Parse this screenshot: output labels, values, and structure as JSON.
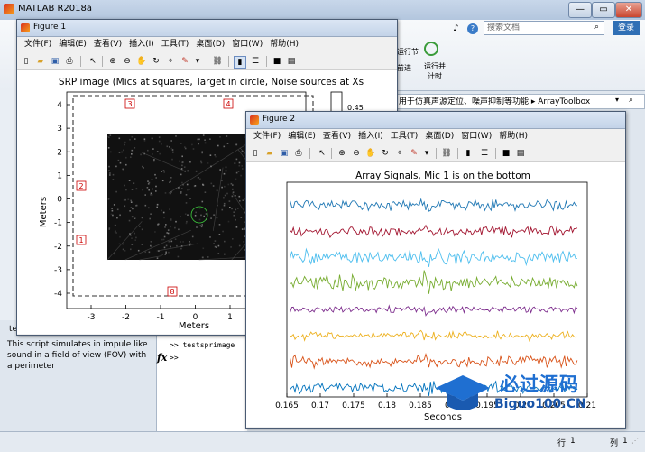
{
  "matlab": {
    "title": "MATLAB R2018a",
    "search_placeholder": "搜索文档",
    "login": "登录",
    "ribbon_run_section": "运行节",
    "ribbon_advance": "前进",
    "ribbon_run_time": "运行并\n计时",
    "path_text": "用于仿真声源定位、噪声抑制等功能 ▸ ArrayToolbox",
    "detail_text": "This script simulates in impule like sound in a field of view (FOV) with a perimeter",
    "cmd_prompt1": ">> testsprimage",
    "cmd_prompt2": ">>",
    "fx": "fx",
    "status_row_label": "行",
    "status_row": "1",
    "status_col_label": "列",
    "status_col": "1",
    "side_label": "te"
  },
  "figure1": {
    "title": "Figure 1",
    "menus": [
      "文件(F)",
      "编辑(E)",
      "查看(V)",
      "插入(I)",
      "工具(T)",
      "桌面(D)",
      "窗口(W)",
      "帮助(H)"
    ],
    "plot_title": "SRP image (Mics at squares, Target in circle, Noise sources at Xs",
    "xlabel": "Meters",
    "ylabel": "Meters",
    "colorbar_tick": "0.45",
    "mics": [
      "1",
      "2",
      "3",
      "4",
      "8"
    ],
    "xticks": [
      "-3",
      "-2",
      "-1",
      "0",
      "1"
    ],
    "yticks": [
      "4",
      "3",
      "2",
      "1",
      "0",
      "-1",
      "-2",
      "-3",
      "-4"
    ]
  },
  "figure2": {
    "title": "Figure 2",
    "menus": [
      "文件(F)",
      "编辑(E)",
      "查看(V)",
      "插入(I)",
      "工具(T)",
      "桌面(D)",
      "窗口(W)",
      "帮助(H)"
    ],
    "plot_title": "Array Signals, Mic 1 is on the bottom",
    "xlabel": "Seconds",
    "xticks": [
      "0.165",
      "0.17",
      "0.175",
      "0.18",
      "0.185",
      "0.19",
      "0.195",
      "0.2",
      "0.205",
      "0.21"
    ]
  },
  "chart_data": [
    {
      "type": "heatmap",
      "title": "SRP image (Mics at squares, Target in circle, Noise sources at Xs",
      "xlabel": "Meters",
      "ylabel": "Meters",
      "xlim": [
        -3.5,
        1.5
      ],
      "ylim": [
        -4.2,
        4.5
      ],
      "mic_labels": [
        "1",
        "2",
        "3",
        "4",
        "8"
      ],
      "grid": false
    },
    {
      "type": "line",
      "title": "Array Signals, Mic 1 is on the bottom",
      "xlabel": "Seconds",
      "xlim": [
        0.165,
        0.21
      ],
      "series_colors": [
        "#1f77b4",
        "#a2142f",
        "#4dbeee",
        "#77ac30",
        "#7e2f8e",
        "#edb120",
        "#d95319",
        "#0072bd"
      ],
      "grid": false
    }
  ],
  "watermark": {
    "line1": "必过源码",
    "line2": "Biguo100.CN"
  }
}
